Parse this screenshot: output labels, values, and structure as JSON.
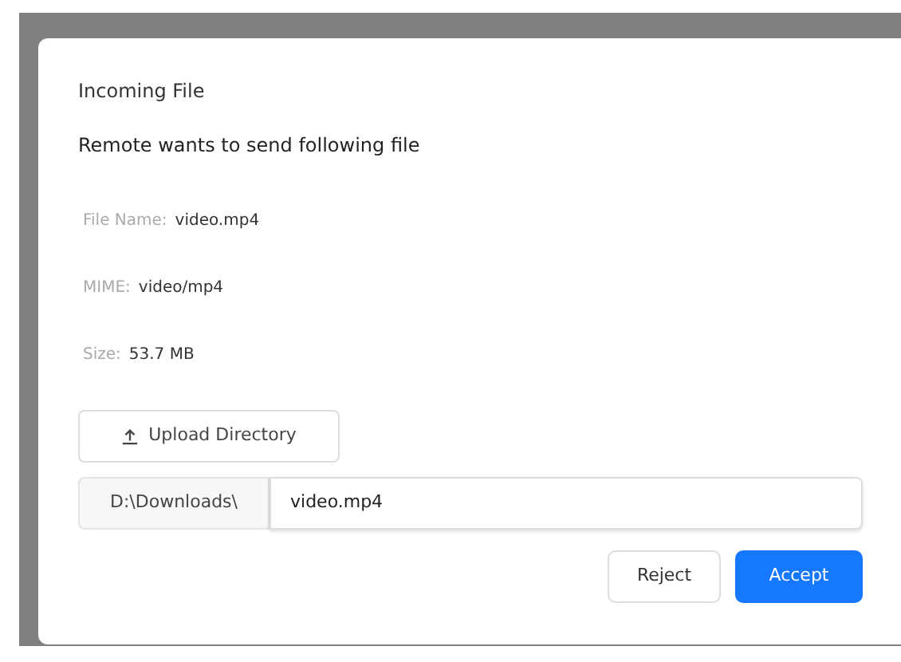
{
  "dialog": {
    "title": "Incoming File",
    "message": "Remote wants to send following file",
    "fields": [
      {
        "label": "File Name:",
        "value": "video.mp4"
      },
      {
        "label": "MIME:",
        "value": "video/mp4"
      },
      {
        "label": "Size:",
        "value": "53.7 MB"
      }
    ],
    "upload_button": "Upload Directory",
    "path": {
      "prefix": "D:\\Downloads\\",
      "value": "video.mp4"
    },
    "buttons": [
      {
        "label": "Reject",
        "kind": "secondary"
      },
      {
        "label": "Accept",
        "kind": "primary"
      }
    ]
  }
}
